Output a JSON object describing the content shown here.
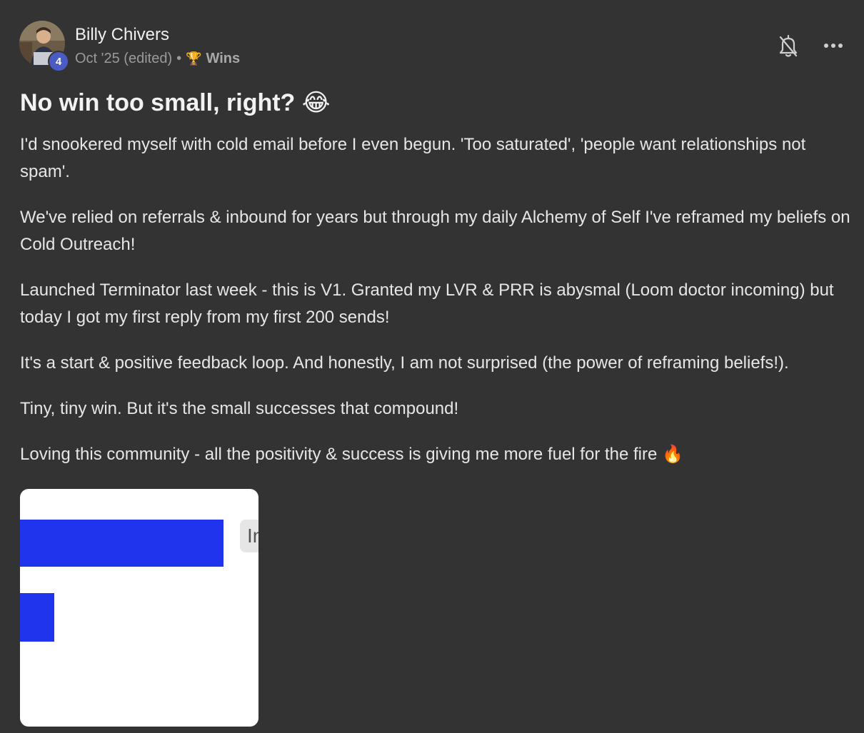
{
  "post": {
    "author": "Billy Chivers",
    "level": "4",
    "date": "Oct '25 (edited)",
    "separator": "•",
    "category_icon": "🏆",
    "category": "Wins",
    "title": "No win too small, right? 😂",
    "paragraphs": [
      "I'd snookered myself with cold email before I even begun. 'Too saturated', 'people want relationships not spam'.",
      "We've relied on referrals & inbound for years but through my daily Alchemy of Self I've reframed my beliefs on Cold Outreach!",
      "Launched Terminator last week - this is V1. Granted my LVR & PRR is abysmal (Loom doctor incoming) but today I got my first reply from my first 200 sends!",
      "It's a start & positive feedback loop. And honestly, I am not surprised (the power of reframing beliefs!).",
      "Tiny, tiny win. But it's the small successes that compound!",
      "Loving this community - all the positivity & success is giving me more fuel for the fire 🔥"
    ],
    "attachment_chip_text": "In"
  },
  "icons": {
    "notifications": "bell-off-icon",
    "more": "more-horizontal-icon"
  },
  "colors": {
    "background": "#333333",
    "badge": "#4a5bc4",
    "chart_bar": "#1f34ec"
  }
}
